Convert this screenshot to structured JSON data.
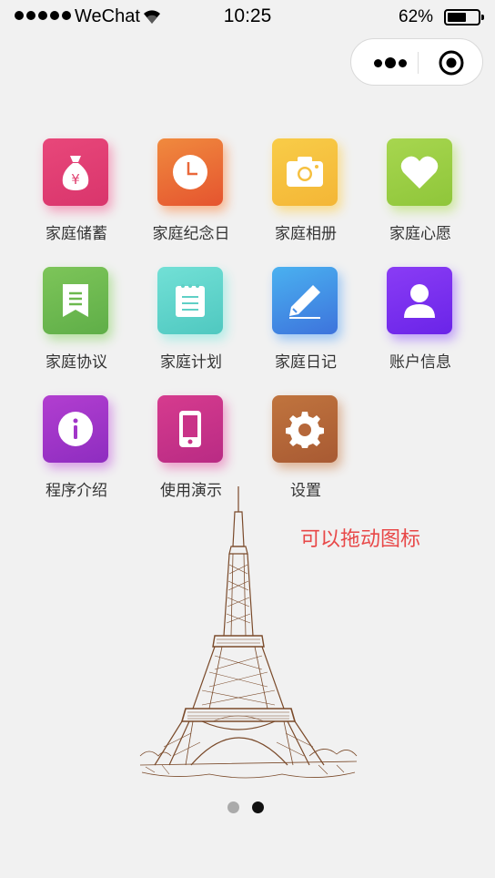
{
  "status_bar": {
    "carrier": "WeChat",
    "time": "10:25",
    "battery": "62%",
    "battery_level": 0.62
  },
  "capsule": {
    "more_icon": "more-dots-icon",
    "close_icon": "target-close-icon"
  },
  "grid": {
    "items": [
      {
        "label": "家庭储蓄",
        "icon": "money-bag-icon",
        "color_from": "#e8477a",
        "color_to": "#d9356c",
        "glow": "#f3a0bd"
      },
      {
        "label": "家庭纪念日",
        "icon": "clock-icon",
        "color_from": "#f08a3e",
        "color_to": "#e5542f",
        "glow": "#f7b38a"
      },
      {
        "label": "家庭相册",
        "icon": "camera-icon",
        "color_from": "#f8cc48",
        "color_to": "#f4b636",
        "glow": "#f9dc8c"
      },
      {
        "label": "家庭心愿",
        "icon": "heart-icon",
        "color_from": "#a7d64f",
        "color_to": "#8fc63a",
        "glow": "#cce69a"
      },
      {
        "label": "家庭协议",
        "icon": "bookmark-doc-icon",
        "color_from": "#7dc559",
        "color_to": "#5fae48",
        "glow": "#b6e0a0"
      },
      {
        "label": "家庭计划",
        "icon": "notepad-icon",
        "color_from": "#72e0d6",
        "color_to": "#4fc8c0",
        "glow": "#aeece6"
      },
      {
        "label": "家庭日记",
        "icon": "pencil-icon",
        "color_from": "#4ab1f0",
        "color_to": "#3d73dc",
        "glow": "#9cc6f4"
      },
      {
        "label": "账户信息",
        "icon": "user-icon",
        "color_from": "#8a3cf5",
        "color_to": "#6a24e8",
        "glow": "#bd9cf7"
      },
      {
        "label": "程序介绍",
        "icon": "info-icon",
        "color_from": "#b23ed0",
        "color_to": "#8e2dc0",
        "glow": "#d79ce6"
      },
      {
        "label": "使用演示",
        "icon": "phone-icon",
        "color_from": "#d63b8e",
        "color_to": "#b92b84",
        "glow": "#eb9cc8"
      },
      {
        "label": "设置",
        "icon": "gear-icon",
        "color_from": "#c0743e",
        "color_to": "#a85a33",
        "glow": "#dcb193"
      }
    ]
  },
  "hint": "可以拖动图标",
  "illustration": "eiffel-tower-sketch",
  "pager": {
    "pages": 2,
    "current": 2,
    "active_color": "#111111",
    "inactive_color": "#aaaaaa"
  }
}
